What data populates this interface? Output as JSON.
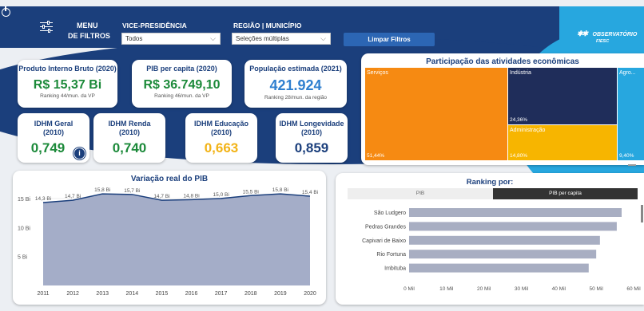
{
  "header": {
    "menu_l1": "MENU",
    "menu_l2": "DE FILTROS",
    "vp_label": "VICE-PRESIDÊNCIA",
    "vp_value": "Todos",
    "reg_label": "REGIÃO | MUNICÍPIO",
    "reg_value": "Seleções múltiplas",
    "clear_btn": "Limpar Filtros",
    "logo_l1": "OBSERVATÓRIO",
    "logo_l2": "FIESC"
  },
  "kpis": [
    {
      "title": "Produto Interno Bruto (2020)",
      "value": "R$ 15,37 Bi",
      "sub": "Ranking 44/mun. da VP",
      "color": "#1c8a3a"
    },
    {
      "title": "PIB per capita (2020)",
      "value": "R$ 36.749,10",
      "sub": "Ranking 46/mun. da VP",
      "color": "#1c8a3a"
    },
    {
      "title": "População estimada (2021)",
      "value": "421.924",
      "sub": "Ranking 28/mun. da região",
      "color": "#2f7fcf"
    }
  ],
  "idhm": [
    {
      "title": "IDHM Geral",
      "year": "(2010)",
      "value": "0,749",
      "color": "#1c8a3a"
    },
    {
      "title": "IDHM Renda",
      "year": "(2010)",
      "value": "0,740",
      "color": "#1c8a3a"
    },
    {
      "title": "IDHM Educação",
      "year": "(2010)",
      "value": "0,663",
      "color": "#f2b317"
    },
    {
      "title": "IDHM Longevidade",
      "year": "(2010)",
      "value": "0,859",
      "color": "#1b3f7c"
    }
  ],
  "treemap": {
    "title": "Participação das atividades econômicas",
    "cells": [
      {
        "name": "Serviços",
        "pct": "51,44%",
        "color": "#f68a12"
      },
      {
        "name": "Indústria",
        "pct": "24,36%",
        "color": "#1f2d5a"
      },
      {
        "name": "Administração",
        "pct": "14,80%",
        "color": "#f7b500"
      },
      {
        "name": "Agro...",
        "pct": "9,40%",
        "color": "#27a7df"
      }
    ]
  },
  "pib_chart": {
    "title": "Variação real do PIB"
  },
  "ranking": {
    "title": "Ranking por:",
    "tabs": [
      "PIB",
      "PIB per capita"
    ],
    "active_tab": 1
  },
  "chart_data": [
    {
      "type": "area",
      "title": "Variação real do PIB",
      "x": [
        "2011",
        "2012",
        "2013",
        "2014",
        "2015",
        "2016",
        "2017",
        "2018",
        "2019",
        "2020"
      ],
      "values": [
        14.3,
        14.7,
        15.8,
        15.7,
        14.7,
        14.8,
        15.0,
        15.5,
        15.8,
        15.4
      ],
      "labels": [
        "14,3 Bi",
        "14,7 Bi",
        "15,8 Bi",
        "15,7 Bi",
        "14,7 Bi",
        "14,8 Bi",
        "15,0 Bi",
        "15,5 Bi",
        "15,8 Bi",
        "15,4 Bi"
      ],
      "yticks": [
        "5 Bi",
        "10 Bi",
        "15 Bi"
      ],
      "ylim": [
        0,
        16.5
      ],
      "color": "#1b3f7c",
      "fill": "#a4adc8"
    },
    {
      "type": "bar",
      "title": "Ranking por:",
      "categories": [
        "São Ludgero",
        "Pedras Grandes",
        "Capivari de Baixo",
        "Rio Fortuna",
        "Imbituba"
      ],
      "values": [
        56800,
        55500,
        51000,
        50000,
        48000
      ],
      "xticks": [
        "0 Mil",
        "10 Mil",
        "20 Mil",
        "30 Mil",
        "40 Mil",
        "50 Mil",
        "60 Mil"
      ],
      "xlim": [
        0,
        60000
      ],
      "color": "#a8aec2"
    }
  ]
}
